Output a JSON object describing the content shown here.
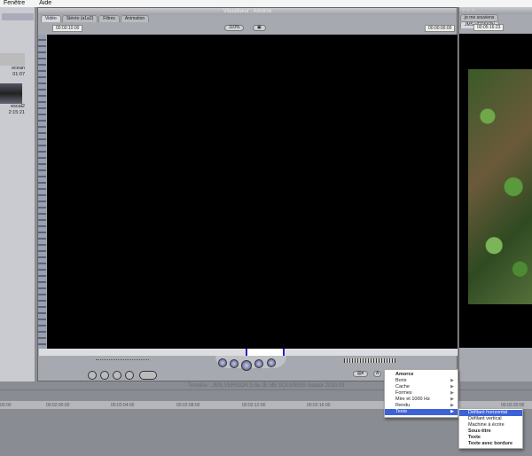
{
  "menubar": {
    "items": [
      "Fenêtre",
      "Aide"
    ]
  },
  "browser": {
    "clips": [
      {
        "name": "ocean",
        "duration": "01:07"
      },
      {
        "name": "escal2",
        "duration": "2:15:21"
      }
    ]
  },
  "viewer": {
    "title": "Visualiseur : Amorce",
    "tabs": [
      "Vidéo",
      "Stéréo (a1a2)",
      "Filtres",
      "Animation"
    ],
    "active_tab": 0,
    "duration": "00:00:10:00",
    "zoom": "110%",
    "view": "▣",
    "current_tc": "00:00:00:00"
  },
  "canvas": {
    "tabs": [
      "je me souviens",
      "JMS VERSION"
    ],
    "timecode": "00:05:16:23"
  },
  "timeline": {
    "title": "Timeline : JMS VERSION 3 de JE ME SOUVIENS master 2010 03",
    "ticks": [
      "00:00",
      "00:02:00:00",
      "00:02:04:00",
      "00:02:08:00",
      "00:02:12:00",
      "00:02:16:00",
      "00:02:20:00"
    ]
  },
  "generator_menu": {
    "items": [
      {
        "label": "Amorce",
        "submenu": false
      },
      {
        "label": "Boris",
        "submenu": true
      },
      {
        "label": "Cache",
        "submenu": true
      },
      {
        "label": "Formes",
        "submenu": true
      },
      {
        "label": "Mire et 1000 Hz",
        "submenu": true
      },
      {
        "label": "Rendu",
        "submenu": true
      },
      {
        "label": "Texte",
        "submenu": true,
        "selected": true
      }
    ]
  },
  "texte_submenu": {
    "items": [
      "Défilant horizontal",
      "Défilant vertical",
      "Machine à écrire",
      "Sous-titre",
      "Texte",
      "Texte avec bordure"
    ],
    "selected": 0
  },
  "colors": {
    "selection": "#3d62d8"
  }
}
